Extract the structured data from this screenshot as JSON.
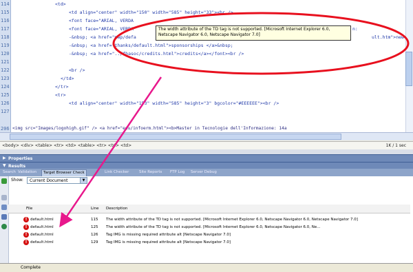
{
  "code": {
    "line_numbers": [
      "114",
      "115",
      "116",
      "117",
      "118",
      "119",
      "120",
      "121",
      "122",
      "123",
      "124",
      "125",
      "126",
      "127"
    ],
    "lines": [
      "<td>",
      "<td align=\"center\" width=\"150\" width=\"585\" height=\"33\"><br />",
      "<font face=\"ARIAL, VERDA",
      "<font face=\"ARIAL, VERDA",
      "-&nbsp; <a href=\"map/defa",
      "-&nbsp; <a href=\"thanks/default.html\">sponsorships </a>&nbsp;",
      "-&nbsp; <a href=\"../fbasoc/credits.html\">credits</a></font><br />",
      "<br />",
      "</td>",
      "</tr>",
      "<tr>",
      "<td align=\"center\" width=\"153\" width=\"585\" height=\"3\" bgcolor=\"#EEEEEE\"><br />",
      "",
      ""
    ],
    "line206_num": "206",
    "line206_text": "<img src=\"Images/logohigh.gif\" /> <a href=\"edu/infoerm.html\"><b>Master in Tecnologie dell'Informazione: 14a",
    "right_frag_1": "ult.htm\">new",
    "right_frag_2": "n:"
  },
  "tooltip": {
    "text": "The width attribute of the TD tag is not supported. [Microsoft Internet Explorer 6.0, Netscape Navigator 6.0, Netscape Navigator 7.0]"
  },
  "tagbar": {
    "crumbs": "<body> <div> <table> <tr> <td> <table> <tr> <td> <td>",
    "size": "1K / 1 sec"
  },
  "panels": {
    "properties": "Properties",
    "results": "Results"
  },
  "tabs": [
    "Search",
    "Validation",
    "Target Browser Check",
    "Link Checker",
    "Site Reports",
    "FTP Log",
    "Server Debug"
  ],
  "results": {
    "show_label": "Show:",
    "show_value": "Current Document",
    "columns": {
      "file": "File",
      "line": "Line",
      "desc": "Description"
    },
    "rows": [
      {
        "file": "default.html",
        "line": "115",
        "desc": "The width attribute of the TD tag is not supported. [Microsoft Internet Explorer 6.0, Netscape Navigator 6.0, Netscape Navigator 7.0]"
      },
      {
        "file": "default.html",
        "line": "125",
        "desc": "The width attribute of the TD tag is not supported. [Microsoft Internet Explorer 6.0, Netscape Navigator 6.0, Ne..."
      },
      {
        "file": "default.html",
        "line": "126",
        "desc": "Tag IMG is missing required attribute alt [Netscape Navigator 7.0]"
      },
      {
        "file": "default.html",
        "line": "129",
        "desc": "Tag IMG is missing required attribute alt [Netscape Navigator 7.0]"
      }
    ],
    "status": "Complete"
  },
  "colors": {
    "annotation": "#e8101e",
    "arrow": "#e8188c"
  }
}
